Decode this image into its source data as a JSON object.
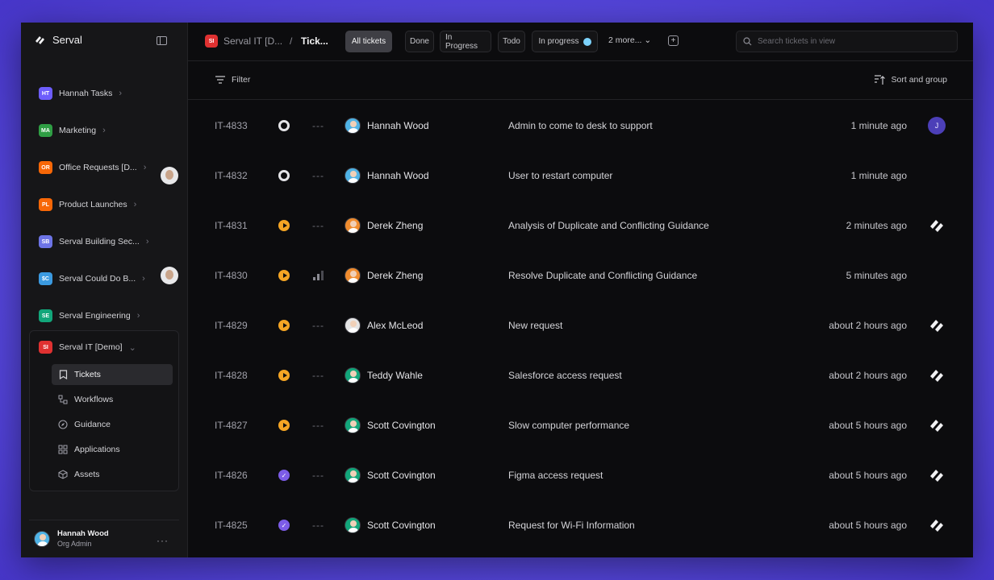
{
  "app": {
    "name": "Serval"
  },
  "sidebar": {
    "teams": [
      {
        "abbr": "HT",
        "label": "Hannah Tasks",
        "color": "#6d5dfc"
      },
      {
        "abbr": "MA",
        "label": "Marketing",
        "color": "#2f9e44"
      },
      {
        "abbr": "OR",
        "label": "Office Requests [D...",
        "color": "#f76707"
      },
      {
        "abbr": "PL",
        "label": "Product Launches",
        "color": "#f76707"
      },
      {
        "abbr": "SB",
        "label": "Serval Building Sec...",
        "color": "#6d74e6"
      },
      {
        "abbr": "$C",
        "label": "Serval Could Do B...",
        "color": "#3b9ae0"
      },
      {
        "abbr": "SE",
        "label": "Serval Engineering",
        "color": "#12a67a"
      }
    ],
    "active_team": {
      "abbr": "SI",
      "label": "Serval IT [Demo]",
      "color": "#e03131"
    },
    "sub_items": [
      {
        "label": "Tickets",
        "icon": "ticket-icon"
      },
      {
        "label": "Workflows",
        "icon": "workflows-icon"
      },
      {
        "label": "Guidance",
        "icon": "compass-icon"
      },
      {
        "label": "Applications",
        "icon": "applications-icon"
      },
      {
        "label": "Assets",
        "icon": "cube-icon"
      }
    ],
    "user": {
      "name": "Hannah Wood",
      "role": "Org Admin"
    }
  },
  "header": {
    "breadcrumb_team_abbr": "SI",
    "breadcrumb_team": "Serval IT [D...",
    "breadcrumb_sep": "/",
    "breadcrumb_page": "Tick...",
    "views": [
      "All tickets",
      "Done",
      "In Progress",
      "Todo",
      "In progress"
    ],
    "more_views": "2 more...",
    "search_placeholder": "Search tickets in view"
  },
  "toolbar": {
    "filter_label": "Filter",
    "sort_label": "Sort and group"
  },
  "tickets": [
    {
      "id": "IT-4833",
      "status": "todo",
      "priority": "---",
      "assignee": "Hannah Wood",
      "title": "Admin to come to desk to support",
      "time": "1 minute ago",
      "requester": "J"
    },
    {
      "id": "IT-4832",
      "status": "todo",
      "priority": "---",
      "assignee": "Hannah Wood",
      "title": "User to restart computer",
      "time": "1 minute ago",
      "requester": "photo"
    },
    {
      "id": "IT-4831",
      "status": "in-progress",
      "priority": "---",
      "assignee": "Derek Zheng",
      "title": "Analysis of Duplicate and Conflicting Guidance",
      "time": "2 minutes ago",
      "requester": "serval-logo"
    },
    {
      "id": "IT-4830",
      "status": "in-progress",
      "priority": "bars",
      "assignee": "Derek Zheng",
      "title": "Resolve Duplicate and Conflicting Guidance",
      "time": "5 minutes ago",
      "requester": "photo"
    },
    {
      "id": "IT-4829",
      "status": "in-progress",
      "priority": "---",
      "assignee": "Alex McLeod",
      "title": "New request",
      "time": "about 2 hours ago",
      "requester": "serval-logo"
    },
    {
      "id": "IT-4828",
      "status": "in-progress",
      "priority": "---",
      "assignee": "Teddy Wahle",
      "title": "Salesforce access request",
      "time": "about 2 hours ago",
      "requester": "serval-logo"
    },
    {
      "id": "IT-4827",
      "status": "in-progress",
      "priority": "---",
      "assignee": "Scott Covington",
      "title": "Slow computer performance",
      "time": "about 5 hours ago",
      "requester": "serval-logo"
    },
    {
      "id": "IT-4826",
      "status": "done",
      "priority": "---",
      "assignee": "Scott Covington",
      "title": "Figma access request",
      "time": "about 5 hours ago",
      "requester": "serval-logo"
    },
    {
      "id": "IT-4825",
      "status": "done",
      "priority": "---",
      "assignee": "Scott Covington",
      "title": "Request for Wi-Fi Information",
      "time": "about 5 hours ago",
      "requester": "serval-logo"
    }
  ],
  "colors": {
    "todo": "#e4e4e7",
    "in_progress": "#f5a524",
    "done": "#7c5ce6",
    "hannah_avatar": "#4fb3e6",
    "derek_avatar": "#f08c2e",
    "teddy_avatar": "#12a67a",
    "scott_avatar": "#12a67a",
    "alex_avatar": "#e5e5e5"
  }
}
